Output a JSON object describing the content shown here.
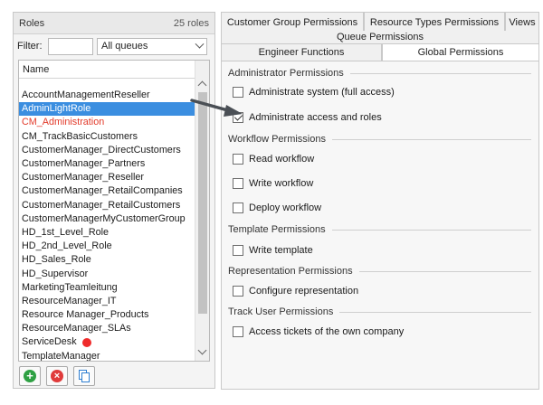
{
  "roles_panel": {
    "title": "Roles",
    "count": "25 roles",
    "filter_label": "Filter:",
    "filter_value": "",
    "queue_select": "All queues",
    "column_header": "Name",
    "items": [
      "AccountManagementReseller",
      "AdminLightRole",
      "CM_Administration",
      "CM_TrackBasicCustomers",
      "CustomerManager_DirectCustomers",
      "CustomerManager_Partners",
      "CustomerManager_Reseller",
      "CustomerManager_RetailCompanies",
      "CustomerManager_RetailCustomers",
      "CustomerManagerMyCustomerGroup",
      "HD_1st_Level_Role",
      "HD_2nd_Level_Role",
      "HD_Sales_Role",
      "HD_Supervisor",
      "MarketingTeamleitung",
      "ResourceManager_IT",
      "Resource Manager_Products",
      "ResourceManager_SLAs",
      "ServiceDesk",
      "TemplateManager"
    ],
    "selected_index": 1,
    "highlighted_red_index": 2,
    "red_dot_index": 18,
    "colors": {
      "selected_bg": "#3b8ee0",
      "red_text": "#e23a2a",
      "red_dot": "#ef2b2b"
    },
    "buttons": {
      "add_icon": "plus-circle-icon",
      "delete_icon": "x-circle-icon",
      "copy_icon": "copy-icon"
    }
  },
  "tabs": {
    "row1": [
      "Customer Group Permissions",
      "Resource Types Permissions",
      "Views"
    ],
    "row2": [
      "Queue Permissions"
    ],
    "row3": [
      "Engineer Functions",
      "Global Permissions"
    ],
    "active": "Global Permissions"
  },
  "permissions": {
    "admin": {
      "title": "Administrator Permissions",
      "items": [
        {
          "label": "Administrate system (full access)",
          "checked": false
        },
        {
          "label": "Administrate access and roles",
          "checked": true
        }
      ]
    },
    "workflow": {
      "title": "Workflow Permissions",
      "items": [
        {
          "label": "Read workflow",
          "checked": false
        },
        {
          "label": "Write workflow",
          "checked": false
        },
        {
          "label": "Deploy workflow",
          "checked": false
        }
      ]
    },
    "template": {
      "title": "Template Permissions",
      "items": [
        {
          "label": "Write template",
          "checked": false
        }
      ]
    },
    "representation": {
      "title": "Representation Permissions",
      "items": [
        {
          "label": "Configure representation",
          "checked": false
        }
      ]
    },
    "track": {
      "title": "Track User Permissions",
      "items": [
        {
          "label": "Access tickets of the own company",
          "checked": false
        }
      ]
    }
  }
}
